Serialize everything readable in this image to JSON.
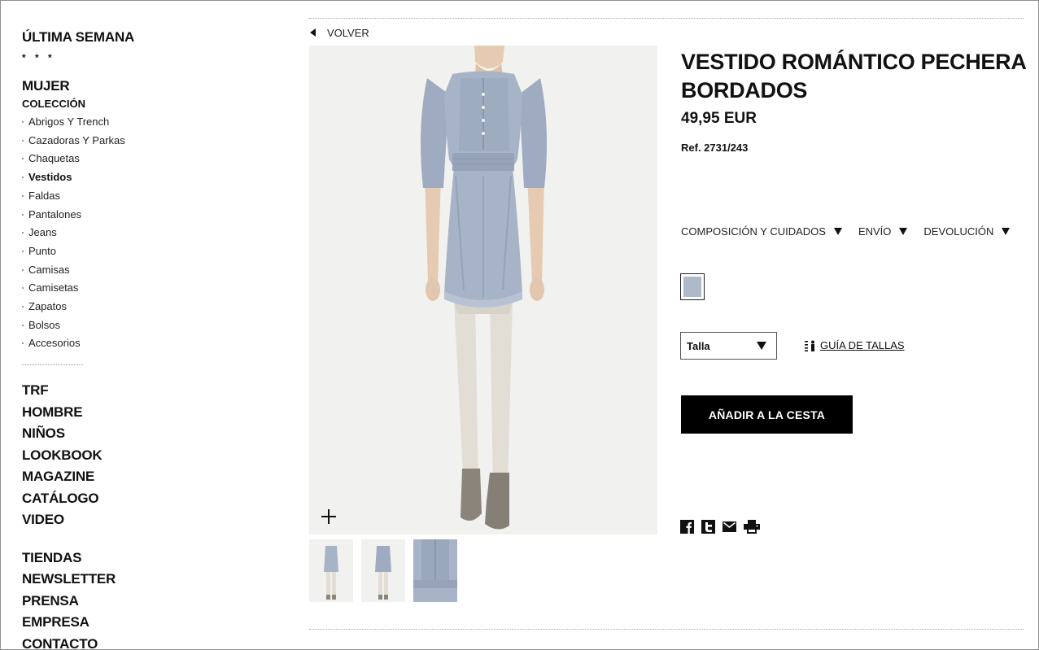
{
  "sidebar": {
    "last_week": "ÚLTIMA SEMANA",
    "stars": "* * *",
    "women": "MUJER",
    "collection": "COLECCIÓN",
    "items": [
      {
        "label": "Abrigos Y Trench"
      },
      {
        "label": "Cazadoras Y Parkas"
      },
      {
        "label": "Chaquetas"
      },
      {
        "label": "Vestidos",
        "active": true
      },
      {
        "label": "Faldas"
      },
      {
        "label": "Pantalones"
      },
      {
        "label": "Jeans"
      },
      {
        "label": "Punto"
      },
      {
        "label": "Camisas"
      },
      {
        "label": "Camisetas"
      },
      {
        "label": "Zapatos"
      },
      {
        "label": "Bolsos"
      },
      {
        "label": "Accesorios"
      }
    ],
    "sections": [
      "TRF",
      "HOMBRE",
      "NIÑOS",
      "LOOKBOOK",
      "MAGAZINE",
      "CATÁLOGO",
      "VIDEO"
    ],
    "footer_links": [
      "TIENDAS",
      "NEWSLETTER",
      "PRENSA",
      "EMPRESA",
      "CONTACTO"
    ]
  },
  "nav": {
    "back_label": "VOLVER",
    "back_icon": "triangle-left-icon"
  },
  "product": {
    "title": "VESTIDO ROMÁNTICO PECHERA BORDADOS",
    "price": "49,95 EUR",
    "ref": "Ref. 2731/243",
    "tabs": [
      "COMPOSICIÓN Y CUIDADOS",
      "ENVÍO",
      "DEVOLUCIÓN"
    ],
    "color_swatch": "#aeb9c9",
    "size_placeholder": "Talla",
    "size_guide_label": "GUÍA DE TALLAS",
    "add_to_cart_label": "AÑADIR A LA CESTA",
    "thumbnails": 3,
    "share_icons": [
      "facebook-icon",
      "twitter-icon",
      "email-icon",
      "print-icon"
    ]
  },
  "colors": {
    "dress": "#a7b4c7",
    "dress_shade": "#8e9bb0",
    "tights": "#e2ded5",
    "boots": "#8a847b",
    "skin": "#e6cbb2",
    "photo_bg": "#f1f1ef"
  }
}
